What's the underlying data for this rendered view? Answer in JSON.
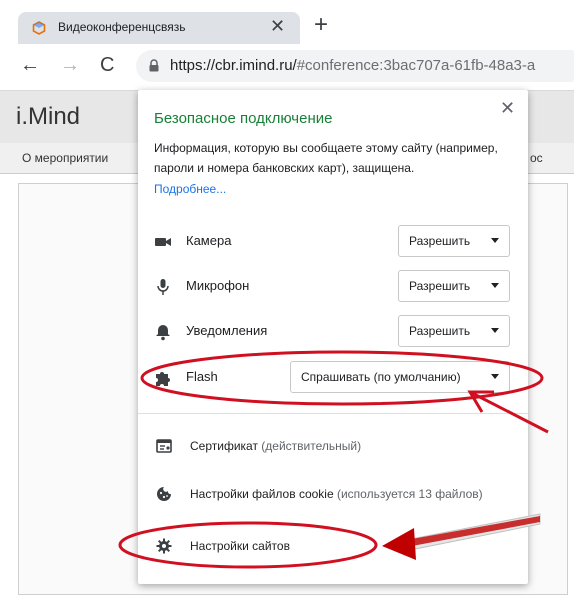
{
  "colors": {
    "secure_green": "#188038",
    "link_blue": "#1a73e8",
    "annotation_red": "#d01020"
  },
  "tab": {
    "title": "Видеоконференцсвязь",
    "close_glyph": "✕",
    "new_tab_glyph": "+"
  },
  "toolbar": {
    "back_glyph": "←",
    "forward_glyph": "→",
    "reload_glyph": "C",
    "url_host": "https://cbr.imind.ru/",
    "url_rest": "#conference:3bac707a-61fb-48a3-a"
  },
  "page": {
    "logo": "i.Mind",
    "nav_left": "О мероприятии",
    "nav_right": "ос"
  },
  "popup": {
    "close_glyph": "✕",
    "title": "Безопасное подключение",
    "description": "Информация, которую вы сообщаете этому сайту (например, пароли и номера банковских карт), защищена.",
    "more_link": "Подробнее...",
    "permissions": [
      {
        "icon": "camera-icon",
        "label": "Камера",
        "value": "Разрешить"
      },
      {
        "icon": "microphone-icon",
        "label": "Микрофон",
        "value": "Разрешить"
      },
      {
        "icon": "bell-icon",
        "label": "Уведомления",
        "value": "Разрешить"
      },
      {
        "icon": "puzzle-icon",
        "label": "Flash",
        "value": "Спрашивать (по умолчанию)"
      }
    ],
    "certificate": {
      "label": "Сертификат",
      "status": "(действительный)"
    },
    "cookies": {
      "label": "Настройки файлов cookie",
      "status": "(используется 13 файлов)"
    },
    "site_settings": "Настройки сайтов"
  }
}
